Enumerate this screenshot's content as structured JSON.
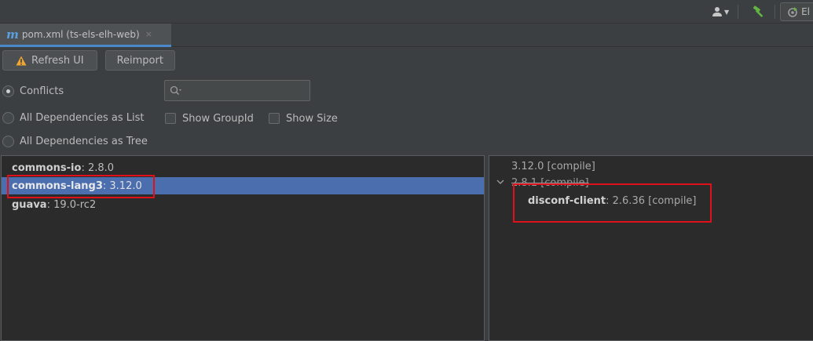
{
  "tab": {
    "label": "pom.xml (ts-els-elh-web)",
    "close_glyph": "×",
    "icon": "maven-m-icon"
  },
  "toolbar": {
    "refresh_label": "Refresh UI",
    "reimport_label": "Reimport"
  },
  "view_modes": [
    {
      "label": "Conflicts",
      "checked": true
    },
    {
      "label": "All Dependencies as List",
      "checked": false
    },
    {
      "label": "All Dependencies as Tree",
      "checked": false
    }
  ],
  "options": {
    "show_groupid": "Show GroupId",
    "show_size": "Show Size"
  },
  "search": {
    "value": "",
    "placeholder": ""
  },
  "top_right": {
    "run_config_label": "El"
  },
  "dependencies": [
    {
      "name": "commons-io",
      "version": " : 2.8.0"
    },
    {
      "name": "commons-lang3",
      "version": " : 3.12.0"
    },
    {
      "name": "guava",
      "version": " : 19.0-rc2"
    }
  ],
  "usages": {
    "row1": "3.12.0 [compile]",
    "row2": "2.8.1 [compile]",
    "row3_name": "disconf-client",
    "row3_version": " : 2.6.36 [compile]"
  },
  "colors": {
    "highlight": "#e0101a",
    "selection": "#4b6eaf",
    "accent": "#4a88c7"
  }
}
